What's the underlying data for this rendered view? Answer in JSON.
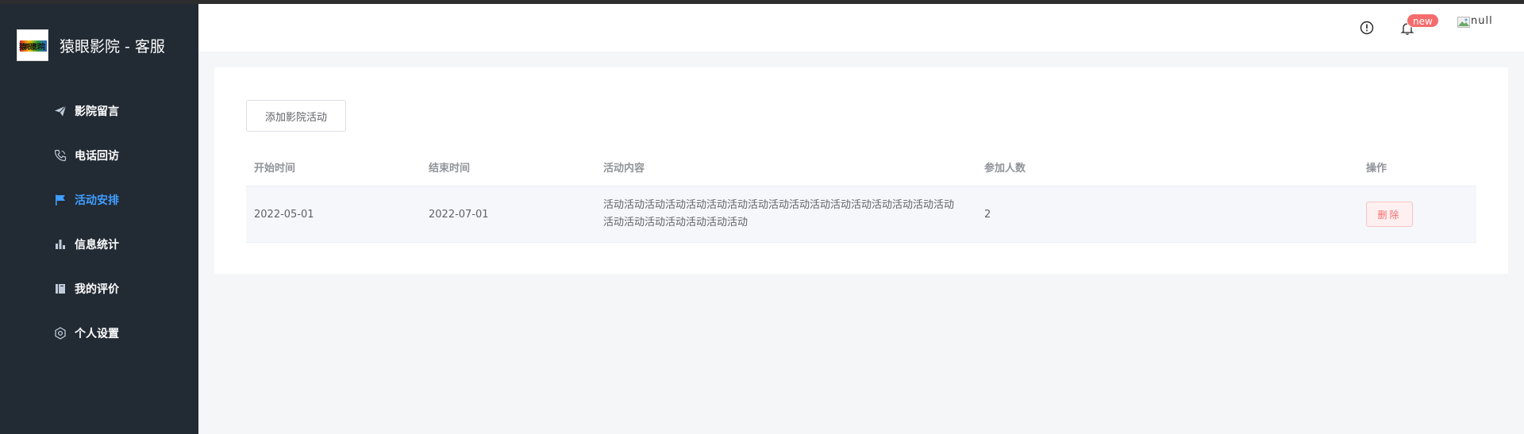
{
  "app": {
    "title": "猿眼影院 - 客服",
    "logo_text": "猿眼影院"
  },
  "sidebar": {
    "items": [
      {
        "label": "影院留言",
        "icon": "paper-plane-icon",
        "active": false
      },
      {
        "label": "电话回访",
        "icon": "phone-icon",
        "active": false
      },
      {
        "label": "活动安排",
        "icon": "flag-icon",
        "active": true
      },
      {
        "label": "信息统计",
        "icon": "bar-chart-icon",
        "active": false
      },
      {
        "label": "我的评价",
        "icon": "notebook-icon",
        "active": false
      },
      {
        "label": "个人设置",
        "icon": "gear-icon",
        "active": false
      }
    ]
  },
  "header": {
    "badge": "new",
    "username": "null"
  },
  "toolbar": {
    "add_label": "添加影院活动"
  },
  "table": {
    "columns": [
      "开始时间",
      "结束时间",
      "活动内容",
      "参加人数",
      "操作"
    ],
    "rows": [
      {
        "start": "2022-05-01",
        "end": "2022-07-01",
        "content": "活动活动活动活动活动活动活动活动活动活动活动活动活动活动活动活动活动活动活动活动活动活动活动活动",
        "count": "2",
        "action": "删除"
      }
    ]
  },
  "colors": {
    "sidebar_bg": "#222a33",
    "accent": "#409eff",
    "danger": "#f56c6c"
  }
}
